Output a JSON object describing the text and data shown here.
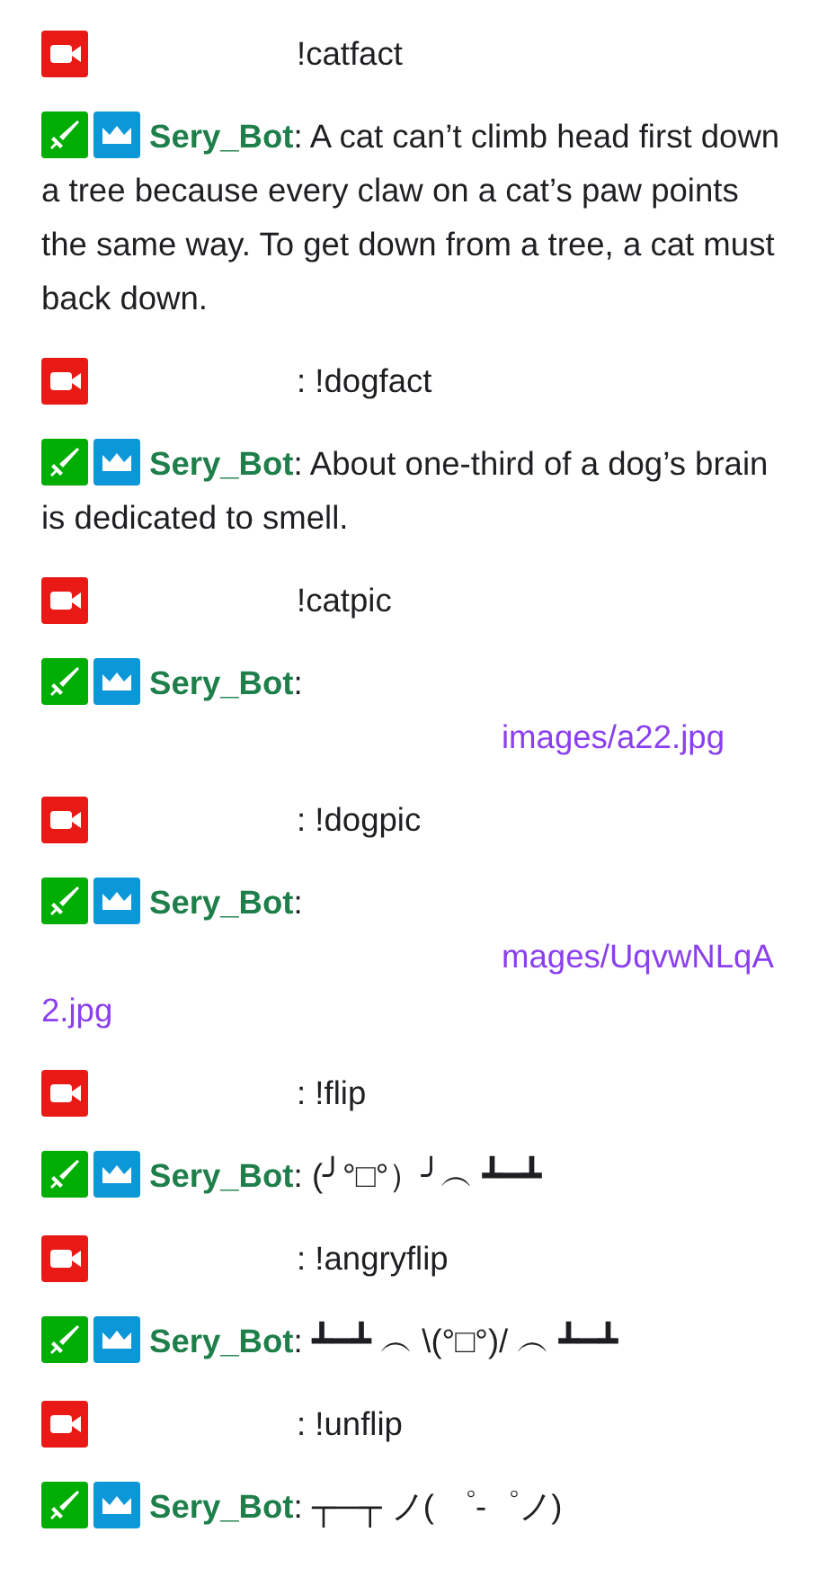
{
  "messages": [
    {
      "kind": "user",
      "badges": [
        {
          "kind": "camera"
        }
      ],
      "text": "!catfact"
    },
    {
      "kind": "bot",
      "badges": [
        {
          "kind": "sword"
        },
        {
          "kind": "crown"
        }
      ],
      "author": "Sery_Bot",
      "text": ": A cat can’t climb head first down a tree because every claw on a cat’s paw points the same way. To get down from a tree, a cat must back down."
    },
    {
      "kind": "user",
      "badges": [
        {
          "kind": "camera"
        }
      ],
      "text": ": !dogfact"
    },
    {
      "kind": "bot",
      "badges": [
        {
          "kind": "sword"
        },
        {
          "kind": "crown"
        }
      ],
      "author": "Sery_Bot",
      "text": ": About one-third of a dog’s brain is dedicated to smell."
    },
    {
      "kind": "user",
      "badges": [
        {
          "kind": "camera"
        }
      ],
      "text": "!catpic"
    },
    {
      "kind": "bot",
      "badges": [
        {
          "kind": "sword"
        },
        {
          "kind": "crown"
        }
      ],
      "author": "Sery_Bot",
      "text": ":",
      "link": "images/a22.jpg"
    },
    {
      "kind": "user",
      "badges": [
        {
          "kind": "camera"
        }
      ],
      "text": ": !dogpic"
    },
    {
      "kind": "bot",
      "badges": [
        {
          "kind": "sword"
        },
        {
          "kind": "crown"
        }
      ],
      "author": "Sery_Bot",
      "text": ":",
      "link": "mages/UqvwNLqA2.jpg"
    },
    {
      "kind": "user",
      "badges": [
        {
          "kind": "camera"
        }
      ],
      "text": ": !flip"
    },
    {
      "kind": "bot",
      "badges": [
        {
          "kind": "sword"
        },
        {
          "kind": "crown"
        }
      ],
      "author": "Sery_Bot",
      "text": ": (╯°□°）╯︵ ┻━┻"
    },
    {
      "kind": "user",
      "badges": [
        {
          "kind": "camera"
        }
      ],
      "text": ": !angryflip"
    },
    {
      "kind": "bot",
      "badges": [
        {
          "kind": "sword"
        },
        {
          "kind": "crown"
        }
      ],
      "author": "Sery_Bot",
      "text": ": ┻━┻ ︵ \\(°□°)/ ︵ ┻━┻"
    },
    {
      "kind": "user",
      "badges": [
        {
          "kind": "camera"
        }
      ],
      "text": ": !unflip"
    },
    {
      "kind": "bot",
      "badges": [
        {
          "kind": "sword"
        },
        {
          "kind": "crown"
        }
      ],
      "author": "Sery_Bot",
      "text": ": ┬─┬ ノ( ゜-゜ノ)"
    }
  ]
}
